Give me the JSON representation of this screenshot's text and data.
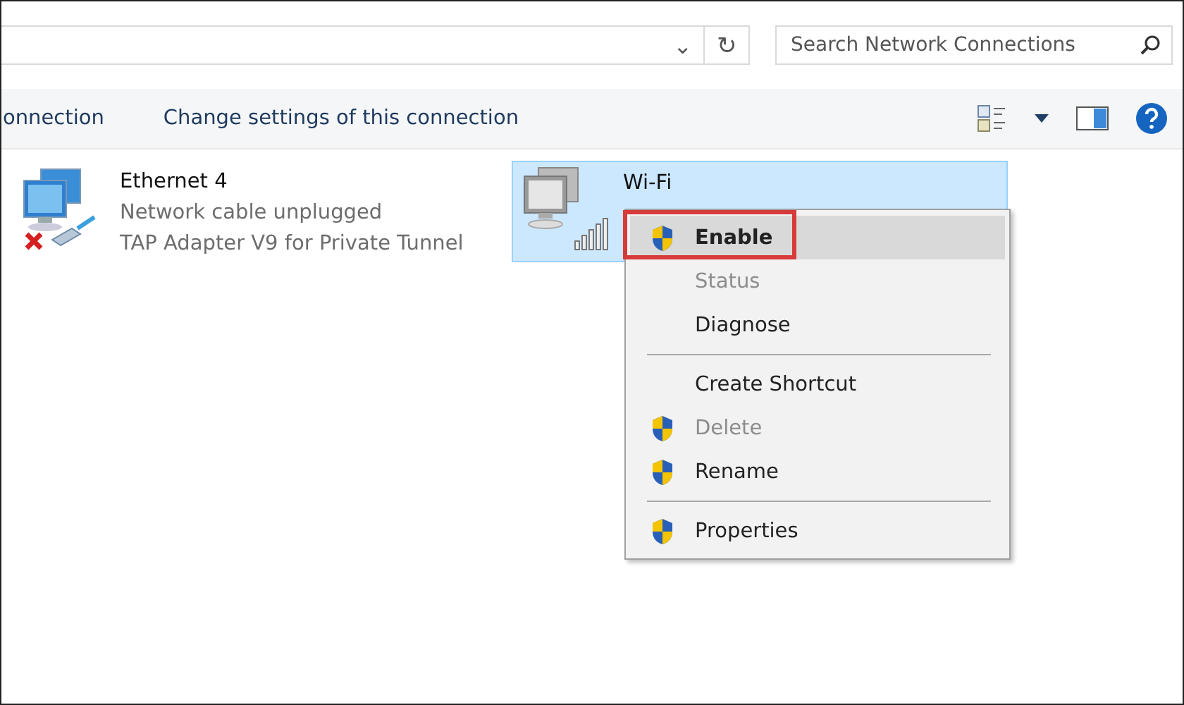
{
  "address_bar": {
    "dropdown": "⌄",
    "refresh": "↻"
  },
  "search": {
    "placeholder": "Search Network Connections"
  },
  "toolbar": {
    "commands": [
      "onnection",
      "Change settings of this connection"
    ]
  },
  "connections": [
    {
      "name": "Ethernet 4",
      "status": "Network cable unplugged",
      "device": "TAP Adapter V9 for Private Tunnel",
      "kind": "ethernet",
      "selected": false
    },
    {
      "name": "Wi-Fi",
      "kind": "wifi",
      "selected": true
    }
  ],
  "context_menu": [
    {
      "kind": "item",
      "label": "Enable",
      "shield": true,
      "disabled": false,
      "default": true,
      "selected": true,
      "outlined": true
    },
    {
      "kind": "item",
      "label": "Status",
      "shield": false,
      "disabled": true,
      "default": false,
      "selected": false,
      "outlined": false
    },
    {
      "kind": "item",
      "label": "Diagnose",
      "shield": false,
      "disabled": false,
      "default": false,
      "selected": false,
      "outlined": false
    },
    {
      "kind": "separator"
    },
    {
      "kind": "item",
      "label": "Create Shortcut",
      "shield": false,
      "disabled": false,
      "default": false,
      "selected": false,
      "outlined": false
    },
    {
      "kind": "item",
      "label": "Delete",
      "shield": true,
      "disabled": true,
      "default": false,
      "selected": false,
      "outlined": false
    },
    {
      "kind": "item",
      "label": "Rename",
      "shield": true,
      "disabled": false,
      "default": false,
      "selected": false,
      "outlined": false
    },
    {
      "kind": "separator"
    },
    {
      "kind": "item",
      "label": "Properties",
      "shield": true,
      "disabled": false,
      "default": false,
      "selected": false,
      "outlined": false
    }
  ]
}
